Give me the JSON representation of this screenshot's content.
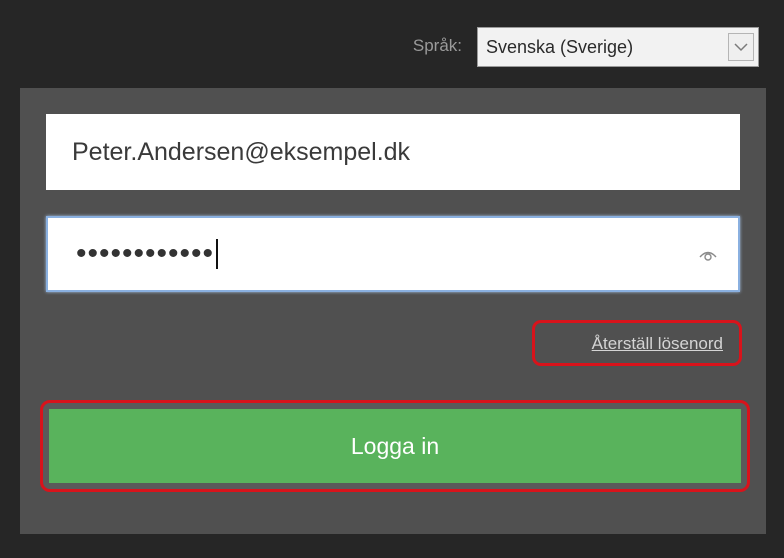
{
  "language": {
    "label": "Språk:",
    "selected": "Svenska (Sverige)",
    "chevron_icon": "chevron-down-icon"
  },
  "login": {
    "email_value": "Peter.Andersen@eksempel.dk",
    "password_masked": "••••••••••••",
    "password_icon": "eye-icon",
    "reset_link": "Återställ lösenord",
    "login_button": "Logga in"
  },
  "colors": {
    "background": "#262626",
    "panel": "#505050",
    "login_button": "#59b35c",
    "highlight": "#d8131b",
    "focus_border": "#8ab0e0"
  }
}
